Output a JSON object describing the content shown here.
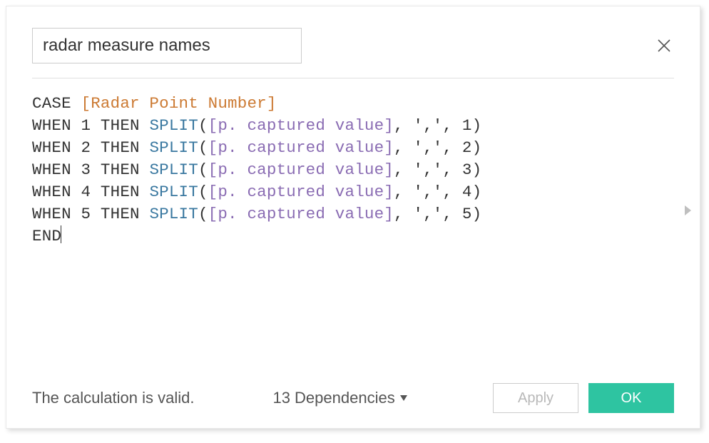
{
  "header": {
    "name_value": "radar measure names"
  },
  "formula": {
    "keyword_case": "CASE",
    "field_main": "[Radar Point Number]",
    "keyword_when": "WHEN",
    "keyword_then": "THEN",
    "func_split": "SPLIT",
    "param_field": "[p. captured value]",
    "sep_literal": "','",
    "keyword_end": "END",
    "lines": [
      {
        "n": "1",
        "idx": "1"
      },
      {
        "n": "2",
        "idx": "2"
      },
      {
        "n": "3",
        "idx": "3"
      },
      {
        "n": "4",
        "idx": "4"
      },
      {
        "n": "5",
        "idx": "5"
      }
    ]
  },
  "footer": {
    "status": "The calculation is valid.",
    "dependencies": "13 Dependencies",
    "apply_label": "Apply",
    "ok_label": "OK"
  },
  "icons": {
    "close": "close-icon",
    "chevron_down": "chevron-down-icon",
    "scroll_right": "chevron-right-icon"
  }
}
